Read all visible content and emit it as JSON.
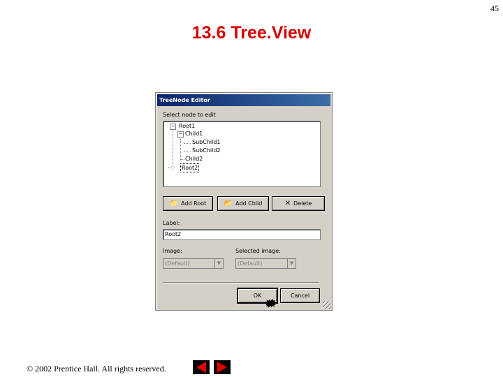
{
  "page_number": "45",
  "slide_title": "13.6 Tree.View",
  "dialog": {
    "title": "TreeNode Editor",
    "select_label": "Select node to edit",
    "tree": {
      "root1": "Root1",
      "child1": "Child1",
      "subchild1": "SubChild1",
      "subchild2": "SubChild2",
      "child2": "Child2",
      "root2": "Root2"
    },
    "buttons": {
      "add_root": "Add Root",
      "add_child": "Add Child",
      "delete": "Delete",
      "ok": "OK",
      "cancel": "Cancel"
    },
    "label_caption": "Label:",
    "label_value": "Root2",
    "image_caption": "Image:",
    "selected_image_caption": "Selected image:",
    "image_value": "(Default)",
    "selected_image_value": "(Default)"
  },
  "icons": {
    "folder": "folder-icon",
    "add_child": "add-child-icon",
    "delete": "delete-x-icon",
    "cursor": "mouse-pointer-icon",
    "prev": "previous-arrow-icon",
    "next": "next-arrow-icon"
  },
  "colors": {
    "title_red": "#d40000",
    "nav_red": "#e00000"
  },
  "footer": {
    "copyright": "© 2002 Prentice Hall.  All rights reserved."
  }
}
